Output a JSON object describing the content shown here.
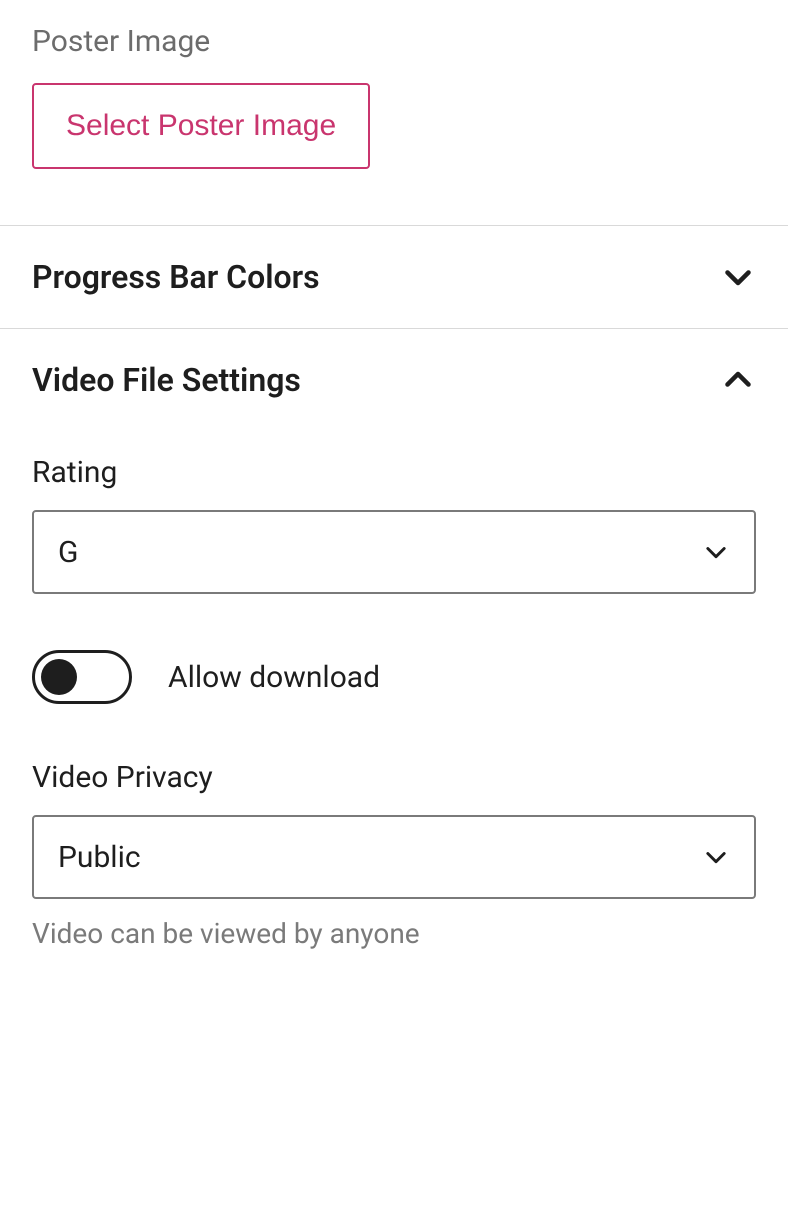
{
  "poster": {
    "heading": "Poster Image",
    "button_label": "Select Poster Image"
  },
  "accordions": {
    "progress_bar": {
      "title": "Progress Bar Colors",
      "expanded": false
    },
    "video_file": {
      "title": "Video File Settings",
      "expanded": true,
      "rating": {
        "label": "Rating",
        "value": "G"
      },
      "allow_download": {
        "label": "Allow download",
        "value": false
      },
      "privacy": {
        "label": "Video Privacy",
        "value": "Public",
        "help": "Video can be viewed by anyone"
      }
    }
  }
}
